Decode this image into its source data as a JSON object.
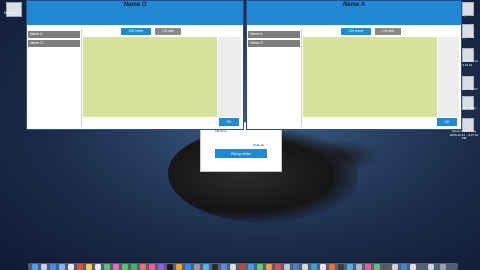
{
  "desktop": {
    "icon_label": "Mvhm"
  },
  "right_icons": [
    {
      "label": "s_"
    },
    {
      "label": "W_11A_4\n...ull"
    },
    {
      "label": "Screen Shot\n2020-12-11\n...4.10.22"
    },
    {
      "label": "Screen Shot\n...10.07"
    },
    {
      "label": "Recording\n...56am"
    },
    {
      "label": "Screen Recording\n2020-12-11\n...4.07.54 PM"
    }
  ],
  "window_left": {
    "title": "Name O",
    "sidebar_items": [
      "Name A",
      "Name O"
    ],
    "tabs": [
      "Chỉ chính",
      "Cả nhà"
    ],
    "ok_label": "OK"
  },
  "window_right": {
    "title": "Name A",
    "sidebar_items": [
      "Name A",
      "Name O"
    ],
    "tabs": [
      "Chỉ chính",
      "Cả nhà"
    ],
    "ok_label": "OK"
  },
  "dialog": {
    "text1": "Mã khóa",
    "text2": "Nhập lại",
    "button": "Đồng nhận"
  },
  "colors": {
    "title_bar": "#1f89d6",
    "content": "#d6e19a",
    "sidebar_item": "#7d7d7d"
  }
}
